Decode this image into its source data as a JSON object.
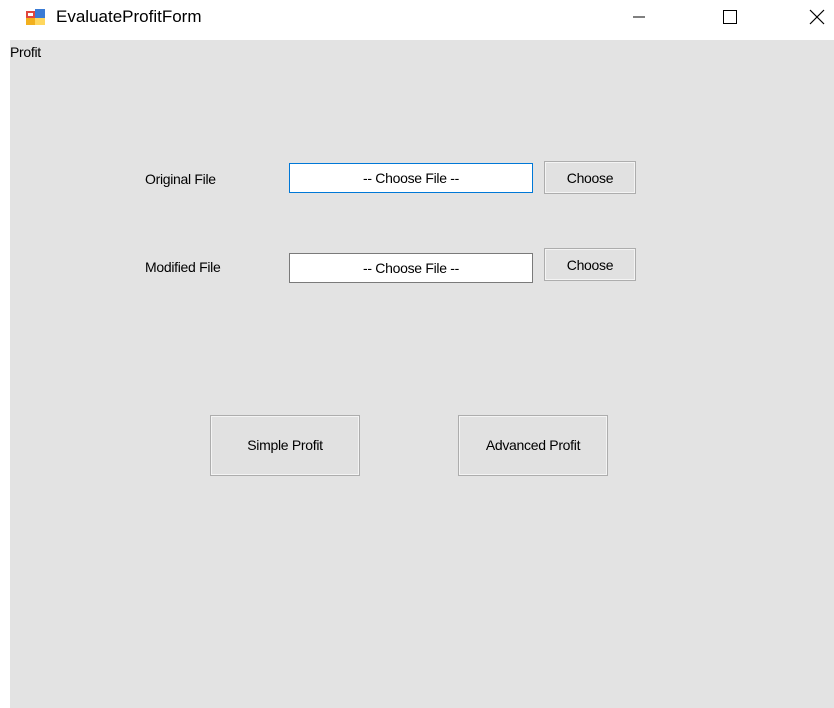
{
  "window": {
    "title": "EvaluateProfitForm",
    "icon": "winforms-app-icon",
    "controls": {
      "minimize": "minimize-icon",
      "maximize": "maximize-icon",
      "close": "close-icon"
    }
  },
  "form": {
    "top_label": "Profit",
    "original": {
      "label": "Original File",
      "value": "-- Choose File --",
      "button": "Choose"
    },
    "modified": {
      "label": "Modified File",
      "value": "-- Choose File --",
      "button": "Choose"
    },
    "actions": {
      "simple": "Simple Profit",
      "advanced": "Advanced Profit"
    }
  },
  "colors": {
    "client_background": "#e3e3e3",
    "button_face": "#e1e1e1",
    "focus_border": "#0078d7"
  }
}
